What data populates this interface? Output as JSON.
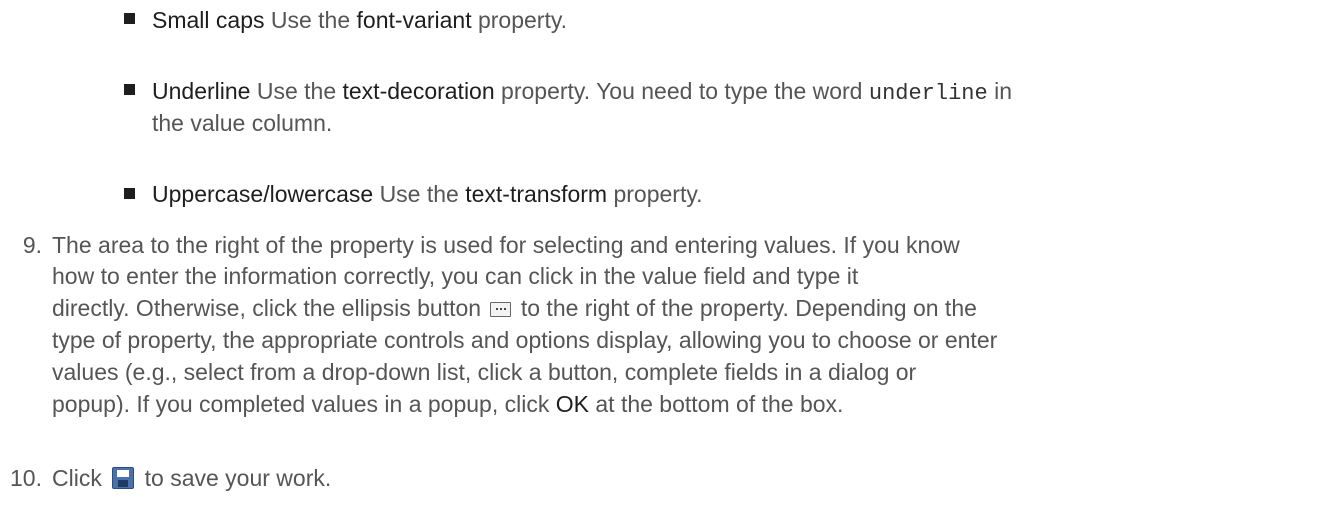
{
  "bullets": [
    {
      "term": "Small caps",
      "lines": [
        [
          {
            "t": "Use the "
          },
          {
            "t": "font-variant",
            "s": 1
          },
          {
            "t": " property."
          }
        ]
      ]
    },
    {
      "term": "Underline",
      "lines": [
        [
          {
            "t": "Use the "
          },
          {
            "t": "text-decoration",
            "s": 1
          },
          {
            "t": " property. You need to type the word "
          },
          {
            "t": "underline",
            "m": 1
          },
          {
            "t": " in"
          }
        ],
        [
          {
            "t": "the value column."
          }
        ]
      ]
    },
    {
      "term": "Uppercase/lowercase",
      "lines": [
        [
          {
            "t": "Use the "
          },
          {
            "t": "text-transform",
            "s": 1
          },
          {
            "t": " property."
          }
        ]
      ]
    }
  ],
  "steps": [
    {
      "number": "9.",
      "lines": [
        "The area to the right of the property is used for selecting and entering values. If you know",
        "how to enter the information correctly, you can click in the value field and type it",
        "directly. Otherwise, click the ellipsis button",
        " to the right of the property. Depending on the",
        "type of property, the appropriate controls and options display, allowing you to choose or enter",
        "values (e.g., select from a drop-down list, click a button, complete fields in a dialog or",
        "popup). If you completed values in a popup, click ",
        "OK",
        " at the bottom of the box."
      ],
      "icon": "ellipsis-button-icon"
    },
    {
      "number": "10.",
      "before": "Click",
      "after": " to save your work.",
      "icon": "save-icon"
    }
  ]
}
